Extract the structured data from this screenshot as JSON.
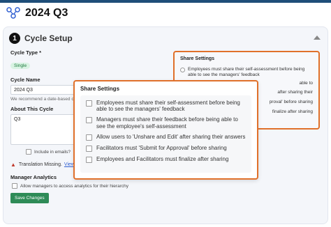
{
  "page": {
    "title": "2024 Q3",
    "section_step": "1",
    "section_title": "Cycle Setup"
  },
  "form": {
    "cycle_type_label": "Cycle Type",
    "cycle_type_required": "*",
    "cycle_type_value": "Single",
    "cycle_name_label": "Cycle Name",
    "cycle_name_value": "2024 Q3",
    "cycle_name_hint": "We recommend a date-based c",
    "about_label": "About This Cycle",
    "about_value": "Q3",
    "include_in_emails": "Include in emails?",
    "warning_text": "Translation Missing.",
    "warning_link": "View",
    "analytics_label": "Manager Analytics",
    "analytics_option": "Allow managers to access analytics for their hierarchy",
    "save_button": "Save Changes"
  },
  "share_settings_back": {
    "title": "Share Settings",
    "items": [
      "Employees must share their self-assessment before being able to see the managers' feedback",
      "able to",
      "after sharing their",
      "proval' before sharing",
      "finalize after sharing"
    ]
  },
  "share_settings_front": {
    "title": "Share Settings",
    "items": [
      "Employees must share their self-assessment before being able to see the managers' feedback",
      "Managers must share their feedback before being able to see the employee's self-assessment",
      "Allow users to 'Unshare and Edit' after sharing their answers",
      "Facilitators must 'Submit for Approval' before sharing",
      "Employees and Facilitators must finalize after sharing"
    ]
  },
  "colors": {
    "accent_orange": "#e0702a",
    "save_green": "#2e8b57",
    "topbar": "#1f4e79"
  }
}
